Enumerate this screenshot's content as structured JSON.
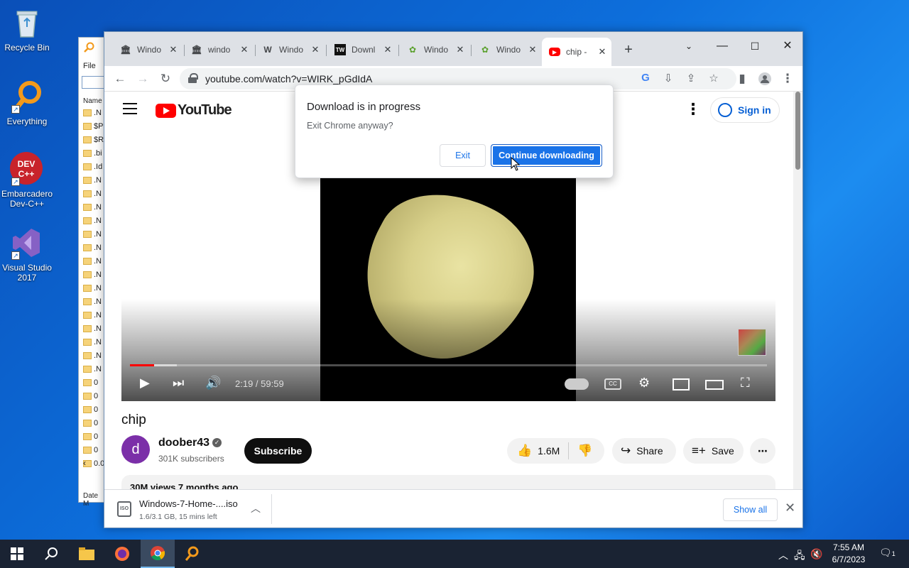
{
  "desktop": {
    "icons": [
      {
        "label": "Recycle Bin"
      },
      {
        "label": "Everything"
      },
      {
        "label": "Embarcadero Dev-C++"
      },
      {
        "label": "Visual Studio 2017"
      }
    ],
    "devcpp_badge": "DEV C++"
  },
  "explorer": {
    "menu_file": "File",
    "col_name": "Name",
    "rows": [
      ".N",
      "$P",
      "$R",
      ".bi",
      ".Id",
      ".N",
      ".N",
      ".N",
      ".N",
      ".N",
      ".N",
      ".N",
      ".N",
      ".N",
      ".N",
      ".N",
      ".N",
      ".N",
      ".N",
      ".N",
      "0",
      "0",
      "0",
      "0",
      "0",
      "0",
      "0.0"
    ],
    "status": "Date M"
  },
  "chrome": {
    "tabs": [
      {
        "title": "Windo",
        "icon": "museum-icon",
        "glyph": "🏛"
      },
      {
        "title": "windo",
        "icon": "museum-icon",
        "glyph": "🏛"
      },
      {
        "title": "Windo",
        "icon": "wikipedia-icon",
        "glyph": "W"
      },
      {
        "title": "Downl",
        "icon": "tenforums-icon",
        "glyph": "TW"
      },
      {
        "title": "Windo",
        "icon": "windows-logo-icon",
        "glyph": "✿"
      },
      {
        "title": "Windo",
        "icon": "windows-logo-icon",
        "glyph": "✿"
      },
      {
        "title": "chip -",
        "icon": "youtube-icon",
        "glyph": "▶",
        "active": true
      }
    ],
    "address": "youtube.com/watch?v=WIRK_pGdIdA"
  },
  "youtube": {
    "logo_text": "YouTube",
    "sign_in": "Sign in",
    "time": "2:19 / 59:59",
    "video_title": "chip",
    "channel_initial": "d",
    "channel_name": "doober43",
    "subscribers": "301K subscribers",
    "subscribe": "Subscribe",
    "likes": "1.6M",
    "share": "Share",
    "save": "Save",
    "views_partial": "30M views  7 months ago",
    "progress_played": 0.038
  },
  "dialog": {
    "title": "Download is in progress",
    "message": "Exit Chrome anyway?",
    "exit": "Exit",
    "continue": "Continue downloading"
  },
  "download_bar": {
    "file": "Windows-7-Home-....iso",
    "status": "1.6/3.1 GB, 15 mins left",
    "show_all": "Show all"
  },
  "taskbar": {
    "time": "7:55 AM",
    "date": "6/7/2023",
    "notifications": "1"
  },
  "colors": {
    "youtube_red": "#ff0000",
    "chrome_blue": "#1a73e8",
    "desktop_blue": "#0d6fdc"
  }
}
